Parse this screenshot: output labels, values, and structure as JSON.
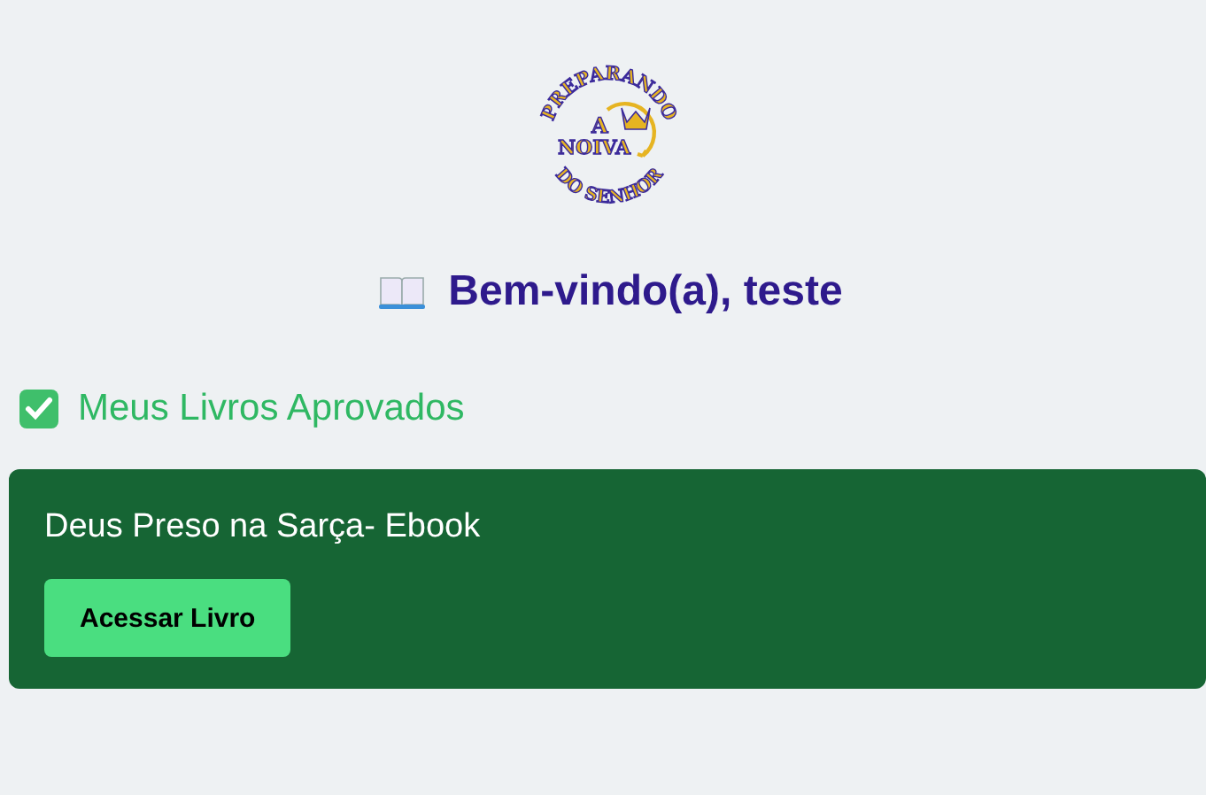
{
  "logo": {
    "top_text": "PREPARANDO",
    "small_text": "A",
    "middle_text": "NOIVA",
    "bottom_text": "DO SENHOR"
  },
  "welcome": {
    "title": "Bem-vindo(a), teste"
  },
  "section": {
    "title": "Meus Livros Aprovados"
  },
  "books": [
    {
      "title": "Deus Preso na Sarça- Ebook",
      "button": "Acessar Livro"
    }
  ]
}
